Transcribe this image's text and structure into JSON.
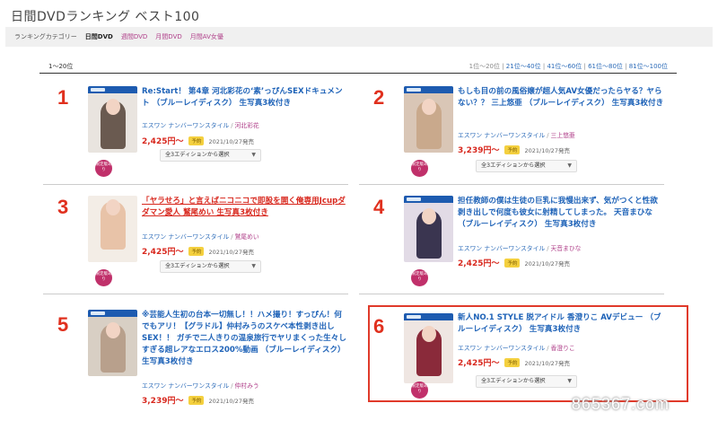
{
  "page_title": "日間DVDランキング ベスト100",
  "category_bar": {
    "label": "ランキングカテゴリー",
    "current": "日間DVD",
    "links": [
      "週間DVD",
      "月間DVD",
      "月間AV女優"
    ]
  },
  "range": {
    "current": "1〜20位",
    "pages": [
      "1位〜20位",
      "21位〜40位",
      "41位〜60位",
      "61位〜80位",
      "81位〜100位"
    ]
  },
  "items": [
    {
      "rank": "1",
      "title": "Re:Start！ 第4章 河北彩花の‘素’っぴんSEXドキュメント （ブルーレイディスク） 生写真3枚付き",
      "maker": "エスワン ナンバーワンスタイル",
      "actress": "河北彩花",
      "price": "2,425円〜",
      "badge": "予約",
      "release": "2021/10/27発売",
      "limited": "限定版あり",
      "edition": "全3エディションから選択"
    },
    {
      "rank": "2",
      "title": "もしも目の前の風俗嬢が超人気AV女優だったらヤる？ヤらない？？ 三上悠亜 （ブルーレイディスク） 生写真3枚付き",
      "maker": "エスワン ナンバーワンスタイル",
      "actress": "三上悠亜",
      "price": "3,239円〜",
      "badge": "予約",
      "release": "2021/10/27発売",
      "limited": "限定版あり",
      "edition": "全3エディションから選択"
    },
    {
      "rank": "3",
      "title": "「ヤラせろ」と言えばニコニコで即股を開く俺専用Jcupダダマン愛人 鷲尾めい 生写真3枚付き",
      "maker": "エスワン ナンバーワンスタイル",
      "actress": "鷲尾めい",
      "price": "2,425円〜",
      "badge": "予約",
      "release": "2021/10/27発売",
      "limited": "限定版あり",
      "edition": "全3エディションから選択"
    },
    {
      "rank": "4",
      "title": "担任教師の僕は生徒の巨乳に我慢出来ず、気がつくと性欲剥き出しで何度も彼女に射精してしまった。 天音まひな （ブルーレイディスク） 生写真3枚付き",
      "maker": "エスワン ナンバーワンスタイル",
      "actress": "天音まひな",
      "price": "2,425円〜",
      "badge": "予約",
      "release": "2021/10/27発売",
      "limited": "限定版あり",
      "edition": "全3エディションから選択"
    },
    {
      "rank": "5",
      "title": "※芸能人生初の台本一切無し！！ハメ撮り！すっぴん！何でもアリ！【グラドル】仲村みうのスケベ本性剥き出しSEX！！ ガチで二人きりの温泉旅行でヤリまくった生々しすぎる超レアなエロス200%動画 （ブルーレイディスク） 生写真3枚付き",
      "maker": "エスワン ナンバーワンスタイル",
      "actress": "仲村みう",
      "price": "3,239円〜",
      "badge": "予約",
      "release": "2021/10/27発売",
      "limited": "",
      "edition": ""
    },
    {
      "rank": "6",
      "title": "新人NO.1 STYLE 脱アイドル 香澄りこ AVデビュー （ブルーレイディスク） 生写真3枚付き",
      "maker": "エスワン ナンバーワンスタイル",
      "actress": "香澄りこ",
      "price": "2,425円〜",
      "badge": "予約",
      "release": "2021/10/27発売",
      "limited": "限定版あり",
      "edition": "全3エディションから選択"
    }
  ],
  "watermark": "865367.com",
  "colors": {
    "rank": "#e0301e",
    "title_link": "#1f63b8",
    "actress_link": "#b0408a",
    "price": "#d8281e",
    "limited_badge": "#c0306a",
    "preorder_badge": "#f4d03f",
    "highlight_box": "#e03a2a"
  }
}
